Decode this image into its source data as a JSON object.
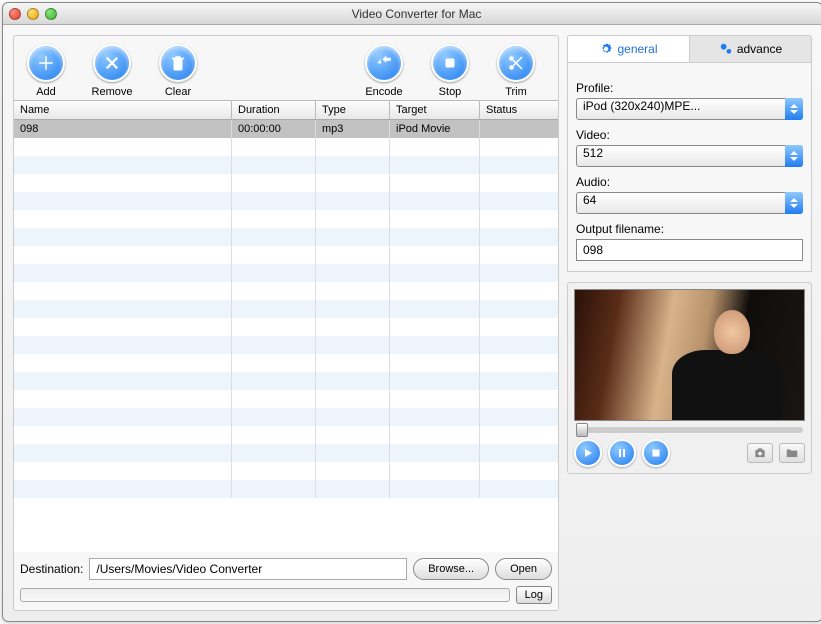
{
  "window": {
    "title": "Video Converter for Mac"
  },
  "toolbar": {
    "add": "Add",
    "remove": "Remove",
    "clear": "Clear",
    "encode": "Encode",
    "stop": "Stop",
    "trim": "Trim"
  },
  "table": {
    "headers": {
      "name": "Name",
      "duration": "Duration",
      "type": "Type",
      "target": "Target",
      "status": "Status"
    },
    "rows": [
      {
        "name": "098",
        "duration": "00:00:00",
        "type": "mp3",
        "target": "iPod Movie",
        "status": ""
      }
    ]
  },
  "destination": {
    "label": "Destination:",
    "path": "/Users/Movies/Video Converter",
    "browse": "Browse...",
    "open": "Open"
  },
  "log": {
    "label": "Log"
  },
  "tabs": {
    "general": "general",
    "advance": "advance"
  },
  "settings": {
    "profile_label": "Profile:",
    "profile_value": "iPod (320x240)MPE...",
    "video_label": "Video:",
    "video_value": "512",
    "audio_label": "Audio:",
    "audio_value": "64",
    "output_label": "Output filename:",
    "output_value": "098"
  }
}
